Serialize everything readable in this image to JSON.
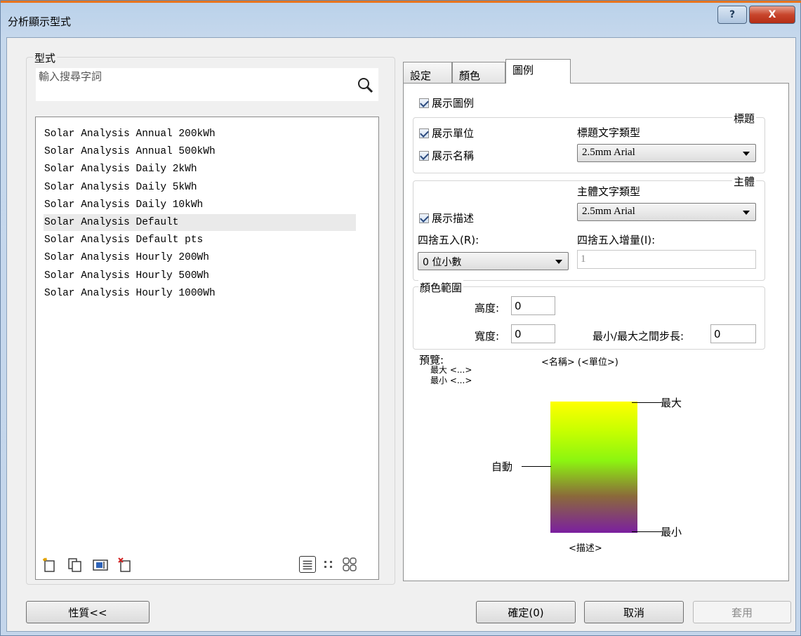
{
  "window": {
    "title": "分析顯示型式",
    "help_label": "?",
    "close_label": "X"
  },
  "left": {
    "group_label": "型式",
    "search_placeholder": "輸入搜尋字詞",
    "items": [
      "Solar Analysis Annual 200kWh",
      "Solar Analysis Annual 500kWh",
      "Solar Analysis Daily 2kWh",
      "Solar Analysis Daily 5kWh",
      "Solar Analysis Daily 10kWh",
      "Solar Analysis Default",
      "Solar Analysis Default pts",
      "Solar Analysis Hourly 200Wh",
      "Solar Analysis Hourly 500Wh",
      "Solar Analysis Hourly 1000Wh"
    ],
    "selected_index": 5
  },
  "tabs": {
    "settings": "設定",
    "color": "顏色",
    "legend": "圖例",
    "active": "legend"
  },
  "legend_tab": {
    "show_legend": "展示圖例",
    "title_group": "標題",
    "show_units": "展示單位",
    "show_name": "展示名稱",
    "title_font_label": "標題文字類型",
    "title_font_value": "2.5mm Arial",
    "body_group": "主體",
    "body_font_label": "主體文字類型",
    "body_font_value": "2.5mm Arial",
    "show_description": "展示描述",
    "rounding_label": "四捨五入(R):",
    "rounding_value": "0 位小數",
    "rounding_increment_label": "四捨五入增量(I):",
    "rounding_increment_value": "1",
    "color_range_group": "顏色範圍",
    "height_label": "高度:",
    "height_value": "0",
    "width_label": "寬度:",
    "width_value": "0",
    "step_label": "最小/最大之間步長:",
    "step_value": "0",
    "preview_label": "預覽:",
    "preview_max": "最大 <...>",
    "preview_min": "最小 <...>",
    "preview_header": "<名稱> (<單位>)",
    "max_label": "最大",
    "auto_label": "自動",
    "min_label": "最小",
    "desc_label": "<描述>"
  },
  "footer": {
    "properties_button": "性質<<",
    "ok_button": "確定(0)",
    "cancel_button": "取消",
    "apply_button": "套用"
  },
  "colors": {
    "titlebar": "#b9d1ea",
    "close_button": "#c8452c",
    "gradient_top": "#ffff00",
    "gradient_mid": "#8cf510",
    "gradient_bottom": "#7b1fa0"
  }
}
